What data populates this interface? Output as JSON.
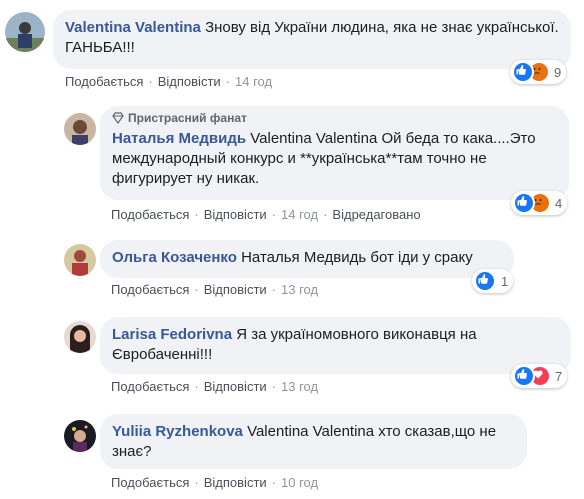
{
  "comments": [
    {
      "author": "Valentina Valentina",
      "text": "Знову від України людина, яка не знає української. ГАНЬБА!!!",
      "actions": {
        "like": "Подобається",
        "reply": "Відповісти",
        "time": "14 год"
      },
      "reaction_count": "9"
    },
    {
      "badge": "Пристрасний фанат",
      "author": "Наталья Медвидь",
      "text": "Valentina Valentina Ой беда то кака....Это международный конкурс и **українська**там точно не фигурирует ну никак.",
      "actions": {
        "like": "Подобається",
        "reply": "Відповісти",
        "time": "14 год",
        "edited": "Відредаговано"
      },
      "reaction_count": "4"
    },
    {
      "author": "Ольга Козаченко",
      "text": "Наталья Медвидь бот іди у сраку",
      "actions": {
        "like": "Подобається",
        "reply": "Відповісти",
        "time": "13 год"
      },
      "reaction_count": "1"
    },
    {
      "author": "Larisa Fedorivna",
      "text": "Я за україномовного виконавця на Євробаченні!!!",
      "actions": {
        "like": "Подобається",
        "reply": "Відповісти",
        "time": "13 год"
      },
      "reaction_count": "7"
    },
    {
      "author": "Yuliia Ryzhenkova",
      "text": "Valentina Valentina хто сказав,що не знає?",
      "actions": {
        "like": "Подобається",
        "reply": "Відповісти",
        "time": "10 год"
      }
    }
  ],
  "colors": {
    "author": "#385898",
    "bubble": "#f0f2f5",
    "like_blue": "#1877f2",
    "haha_orange": "#f7b125",
    "angry_red": "#e9710f",
    "love_red": "#f33e58"
  }
}
